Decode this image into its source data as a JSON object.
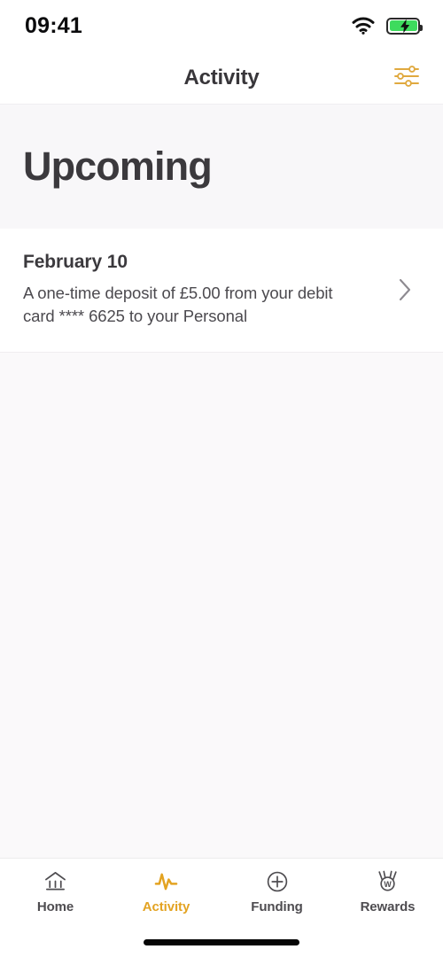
{
  "status_bar": {
    "time": "09:41",
    "wifi_icon": "wifi-icon",
    "battery_icon": "battery-charging-icon"
  },
  "header": {
    "title": "Activity",
    "filter_icon": "sliders-filter-icon"
  },
  "section": {
    "title": "Upcoming"
  },
  "activity_items": [
    {
      "date": "February 10",
      "description": "A one-time deposit of £5.00 from your debit card **** 6625 to your Personal",
      "chevron_icon": "chevron-right-icon"
    }
  ],
  "tabbar": {
    "items": [
      {
        "label": "Home",
        "icon": "bank-home-icon",
        "active": false
      },
      {
        "label": "Activity",
        "icon": "pulse-activity-icon",
        "active": true
      },
      {
        "label": "Funding",
        "icon": "plus-circle-icon",
        "active": false
      },
      {
        "label": "Rewards",
        "icon": "medal-w-icon",
        "active": false
      }
    ]
  },
  "colors": {
    "accent_gold": "#e3a322",
    "text_dark": "#3b393d",
    "text_body": "#4c4a4f",
    "page_bg": "#faf9fa",
    "card_bg": "#ffffff",
    "battery_green": "#3ddb5d"
  }
}
